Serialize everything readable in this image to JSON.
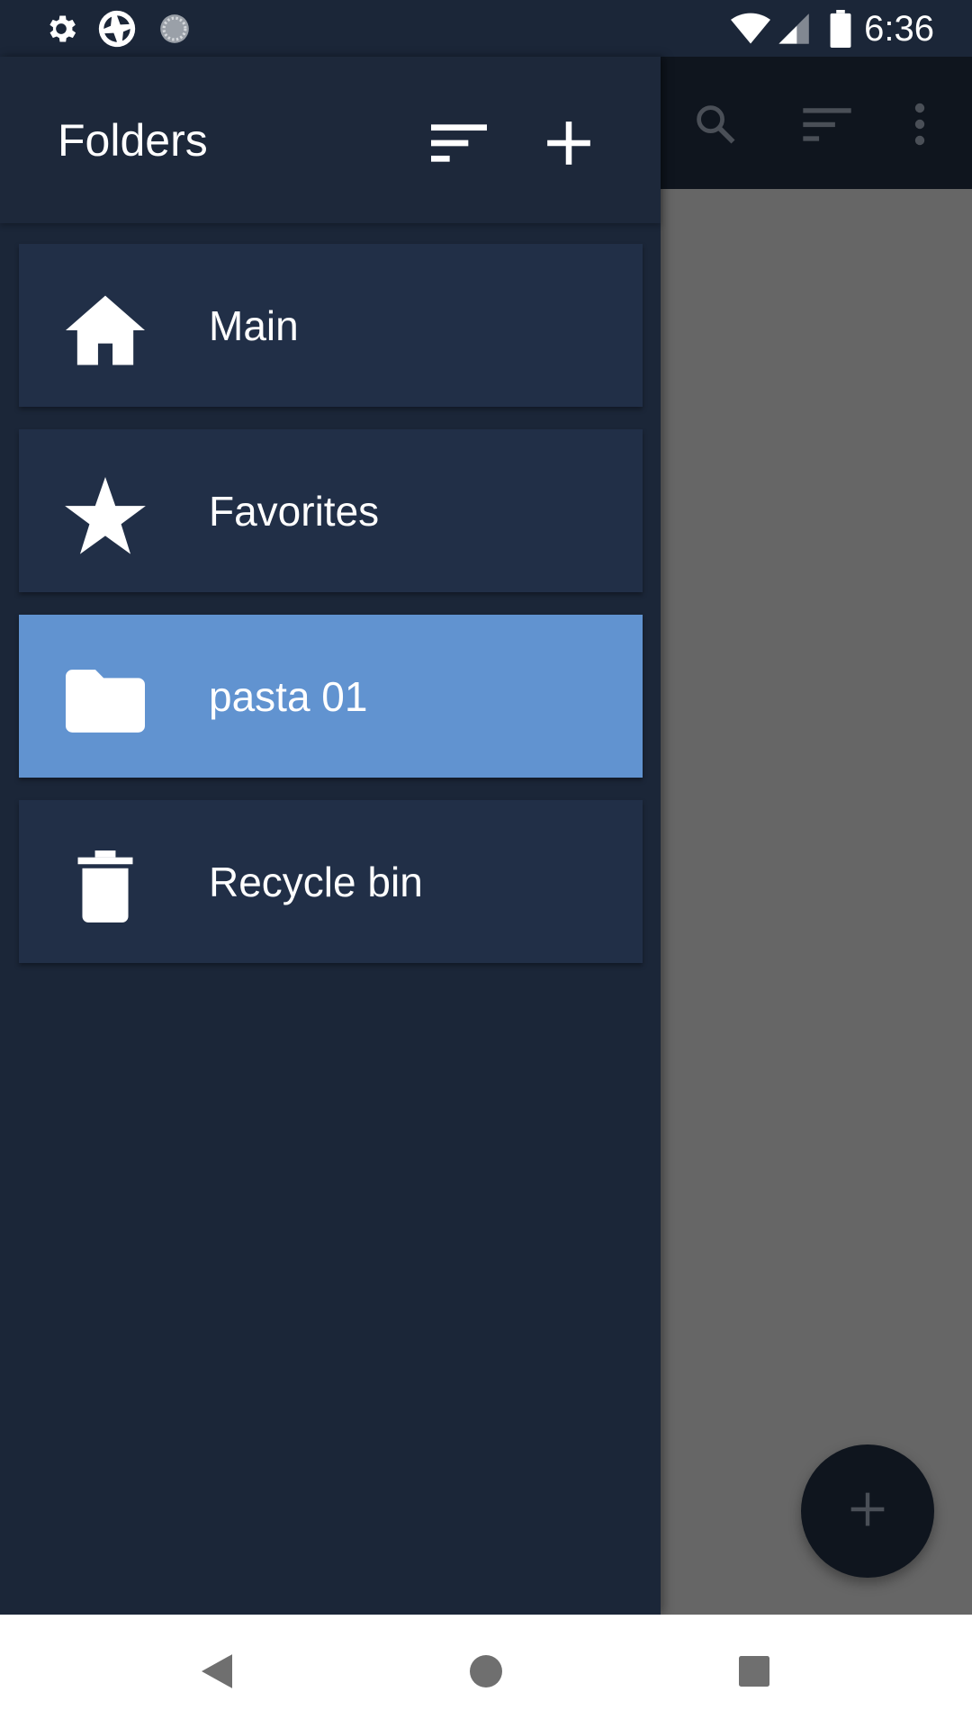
{
  "status_bar": {
    "time": "6:36",
    "icons": [
      "settings-icon",
      "app-shutter-icon",
      "sync-spinner-icon",
      "wifi-icon",
      "cell-signal-icon",
      "battery-icon"
    ]
  },
  "drawer": {
    "title": "Folders",
    "actions": [
      "sort-icon",
      "add-icon"
    ],
    "items": [
      {
        "label": "Main",
        "icon": "home-icon",
        "selected": false
      },
      {
        "label": "Favorites",
        "icon": "star-icon",
        "selected": false
      },
      {
        "label": "pasta 01",
        "icon": "folder-icon",
        "selected": true
      },
      {
        "label": "Recycle bin",
        "icon": "trash-icon",
        "selected": false
      }
    ]
  },
  "main_app_bar": {
    "actions": [
      "search-icon",
      "sort-icon",
      "more-vert-icon"
    ]
  },
  "fab": {
    "icon": "add-icon"
  },
  "nav_bar": {
    "buttons": [
      "back-icon",
      "home-circle-icon",
      "recents-icon"
    ]
  },
  "colors": {
    "drawer_bg": "#1b2638",
    "item_bg": "#212f47",
    "selected_item_bg": "#6193d0",
    "scrim": "#666666",
    "app_bar_dim": "#0f151e"
  }
}
